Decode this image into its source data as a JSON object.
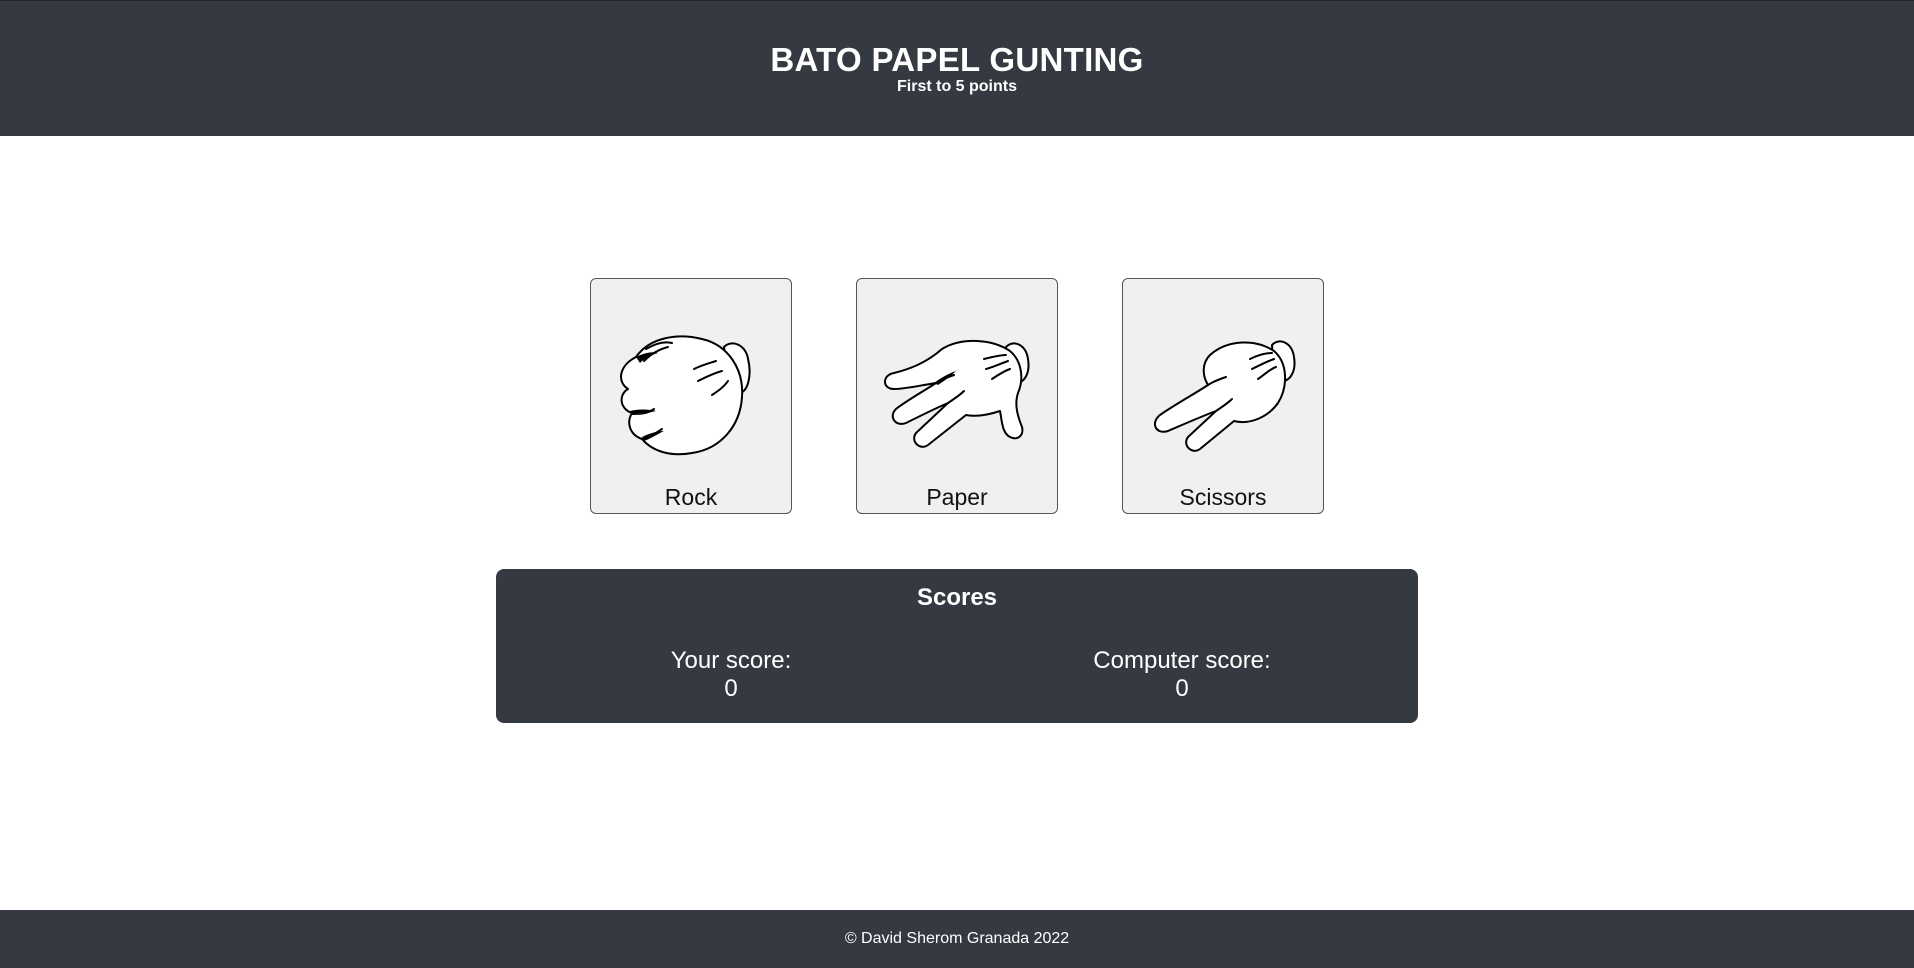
{
  "header": {
    "title": "BATO PAPEL GUNTING",
    "subtitle": "First to 5 points"
  },
  "choices": [
    {
      "label": "Rock",
      "icon": "fist-glove-icon"
    },
    {
      "label": "Paper",
      "icon": "open-hand-glove-icon"
    },
    {
      "label": "Scissors",
      "icon": "two-finger-glove-icon"
    }
  ],
  "scores": {
    "title": "Scores",
    "player_label": "Your score:",
    "player_value": "0",
    "computer_label": "Computer score:",
    "computer_value": "0"
  },
  "footer": {
    "text": "© David Sherom Granada 2022"
  },
  "colors": {
    "bar_bg": "#353a42",
    "card_bg": "#f0f0f0"
  }
}
